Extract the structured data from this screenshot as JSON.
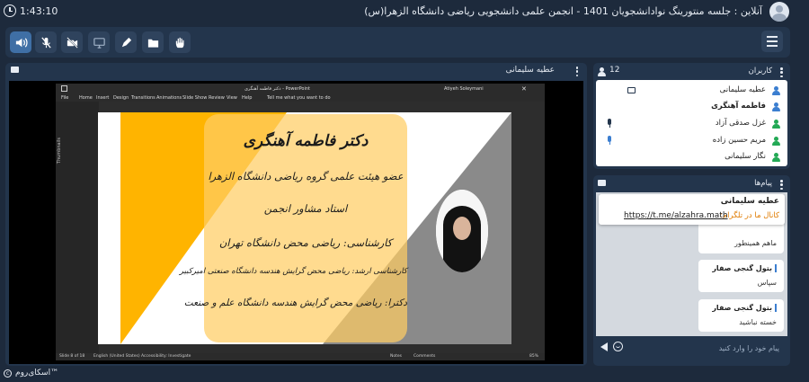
{
  "session": {
    "timer": "1:43:10",
    "title": "آنلاین : جلسه منتورینگ نوادانشجویان 1401 - انجمن علمی دانشجویی ریاضی دانشگاه الزهرا(س)"
  },
  "toolbar": {
    "buttons": [
      "speaker-icon",
      "mic-off-icon",
      "camera-off-icon",
      "screen-share-icon",
      "pen-icon",
      "folder-icon",
      "hand-raise-icon"
    ],
    "active_color": "#3f6fa5",
    "menu_icon": "hamburger-icon"
  },
  "presenter": {
    "name": "عطیه سلیمانی"
  },
  "powerpoint": {
    "file_title": "دکتر فاطمه آهنگری - PowerPoint",
    "user": "Atiyeh Soleymani",
    "menu": [
      "File",
      "Home",
      "Insert",
      "Design",
      "Transitions",
      "Animations",
      "Slide Show",
      "Review",
      "View",
      "Help"
    ],
    "search_hint": "Tell me what you want to do",
    "thumbnails_label": "Thumbnails",
    "status_slide": "Slide 8 of 18",
    "status_lang": "English (United States)",
    "status_accessibility": "Accessibility: Investigate",
    "status_notes": "Notes",
    "status_comments": "Comments",
    "status_zoom": "85%"
  },
  "slide": {
    "heading": "دکتر فاطمه آهنگری",
    "lines": [
      "عضو هیئت علمی گروه ریاضی دانشگاه الزهرا",
      "استاد مشاور انجمن",
      "کارشناسی: ریاضی محض دانشگاه تهران",
      "کارشناسی ارشد: ریاضی محض گرایش هندسه دانشگاه صنعتی امیرکبیر",
      "دکترا: ریاضی محض گرایش هندسه دانشگاه علم و صنعت"
    ],
    "colors": {
      "gold": "#ffb400",
      "gray": "#8a8a8a",
      "card": "#ffd27a"
    }
  },
  "participants": {
    "title": "کاربران",
    "count": "12",
    "items": [
      {
        "name": "عطیه سلیمانی",
        "role_color": "#3b7ed0",
        "status": "screen-share-icon",
        "bold": false
      },
      {
        "name": "فاطمه آهنگری",
        "role_color": "#3b7ed0",
        "status": "",
        "bold": true
      },
      {
        "name": "غزل صدقی آزاد",
        "role_color": "#23a955",
        "status": "mic-icon",
        "status_color": "#23354c",
        "bold": false
      },
      {
        "name": "مریم حسین زاده",
        "role_color": "#23a955",
        "status": "mic-icon",
        "status_color": "#3b7ed0",
        "bold": false
      },
      {
        "name": "نگار سلیمانی",
        "role_color": "#23a955",
        "status": "",
        "bold": false
      }
    ]
  },
  "chat": {
    "title": "پیام‌ها",
    "pinned": {
      "sender": "عطیه سلیمانی",
      "label": "کانال ما در تلگرام:",
      "link": "https://t.me/alzahra.math"
    },
    "messages": [
      {
        "sender": "",
        "text": "ماهم همینطور"
      },
      {
        "sender": "بتول گنجی صفار",
        "text": "سپاس"
      },
      {
        "sender": "بتول گنجی صفار",
        "text": "خسته نباشید"
      }
    ],
    "input_placeholder": "پیام خود را وارد کنید"
  },
  "footer": {
    "brand": "اسکای‌روم™"
  }
}
